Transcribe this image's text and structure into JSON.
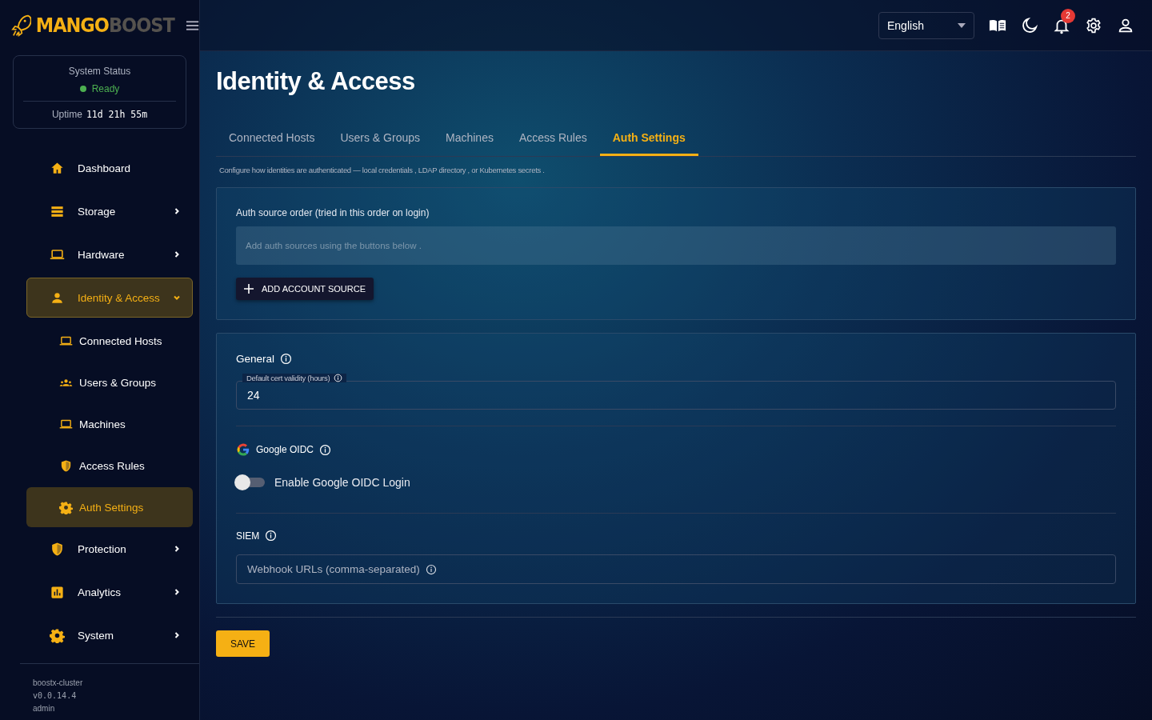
{
  "brand": {
    "part_1": "MANGO",
    "part_2": "BOOST"
  },
  "status_card": {
    "title": "System Status",
    "state": "Ready",
    "color": "#4caf50",
    "uptime_label": "Uptime",
    "uptime": "11d 21h 55m"
  },
  "sidebar": {
    "items": [
      {
        "label": "Dashboard",
        "has_submenu": false,
        "selected": false
      },
      {
        "label": "Storage",
        "has_submenu": true,
        "expanded": false,
        "selected": false
      },
      {
        "label": "Hardware",
        "has_submenu": true,
        "expanded": false,
        "selected": false
      },
      {
        "label": "Identity & Access",
        "has_submenu": true,
        "expanded": true,
        "selected": true,
        "children": [
          {
            "label": "Connected Hosts",
            "selected": false
          },
          {
            "label": "Users & Groups",
            "selected": false
          },
          {
            "label": "Machines",
            "selected": false
          },
          {
            "label": "Access Rules",
            "selected": false
          },
          {
            "label": "Auth Settings",
            "selected": true
          }
        ]
      },
      {
        "label": "Protection",
        "has_submenu": true,
        "expanded": false,
        "selected": false
      },
      {
        "label": "Analytics",
        "has_submenu": true,
        "expanded": false,
        "selected": false
      },
      {
        "label": "System",
        "has_submenu": true,
        "expanded": false,
        "selected": false
      }
    ],
    "footer": {
      "cluster": "boostx-cluster",
      "version": "v0.0.14.4",
      "user": "admin"
    }
  },
  "header": {
    "language": "English",
    "notification_count": "2"
  },
  "page": {
    "title": "Identity & Access",
    "tabs": [
      {
        "label": "Connected Hosts",
        "selected": false
      },
      {
        "label": "Users & Groups",
        "selected": false
      },
      {
        "label": "Machines",
        "selected": false
      },
      {
        "label": "Access Rules",
        "selected": false
      },
      {
        "label": "Auth Settings",
        "selected": true
      }
    ],
    "description": "Configure how identities are authenticated — local credentials , LDAP directory , or Kubernetes secrets .",
    "auth_sources": {
      "label": "Auth source order (tried in this order on login)",
      "empty_text": "Add auth sources using the buttons below .",
      "add_button": "ADD ACCOUNT SOURCE"
    },
    "general": {
      "title": "General",
      "cert_validity": {
        "label": "Default cert validity (hours)",
        "value": "24"
      }
    },
    "google_oidc": {
      "title": "Google OIDC",
      "toggle": {
        "label": "Enable Google OIDC Login",
        "on": false
      }
    },
    "siem": {
      "title": "SIEM",
      "webhook": {
        "placeholder": "Webhook URLs (comma-separated)"
      }
    },
    "save_button": "SAVE"
  }
}
